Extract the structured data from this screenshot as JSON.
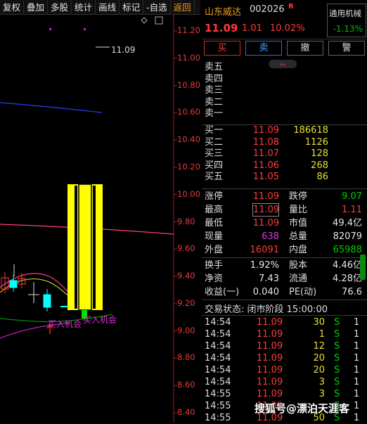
{
  "toolbar": {
    "items": [
      "复权",
      "叠加",
      "多股",
      "统计",
      "画线",
      "标记",
      "-自选",
      "返回"
    ]
  },
  "chart": {
    "price_labels": [
      "11.20",
      "11.00",
      "10.80",
      "10.60",
      "10.40",
      "10.20",
      "10.00",
      "9.80",
      "9.60",
      "9.40",
      "9.20",
      "9.00",
      "8.80",
      "8.60",
      "8.40"
    ],
    "high_marker": "11.09",
    "annotation_buy": "买入机会",
    "annotation_buy2": "买入机会",
    "colors": {
      "up": "#ffff00",
      "down": "#00ffff",
      "axis": "#e03c3c",
      "ma_blue": "#2a3aff",
      "ma_pink": "#ff3c8c",
      "ma_purple": "#c020c0"
    }
  },
  "stock": {
    "name": "山东威达",
    "code": "002026",
    "flag": "R",
    "price": "11.09",
    "change": "1.01",
    "change_pct": "10.02%",
    "sector_name": "通用机械",
    "sector_pct": "-1.13%"
  },
  "actions": {
    "buy": "买",
    "sell": "卖",
    "cancel": "撤",
    "alert": "警"
  },
  "asks": [
    {
      "label": "卖五",
      "price": "",
      "vol": ""
    },
    {
      "label": "卖四",
      "price": "",
      "vol": ""
    },
    {
      "label": "卖三",
      "price": "",
      "vol": ""
    },
    {
      "label": "卖二",
      "price": "",
      "vol": ""
    },
    {
      "label": "卖一",
      "price": "",
      "vol": ""
    }
  ],
  "bids": [
    {
      "label": "买一",
      "price": "11.09",
      "vol": "186618"
    },
    {
      "label": "买二",
      "price": "11.08",
      "vol": "1126"
    },
    {
      "label": "买三",
      "price": "11.07",
      "vol": "128"
    },
    {
      "label": "买四",
      "price": "11.06",
      "vol": "268"
    },
    {
      "label": "买五",
      "price": "11.05",
      "vol": "86"
    }
  ],
  "stats": {
    "limit_up_label": "涨停",
    "limit_up": "11.09",
    "limit_down_label": "跌停",
    "limit_down": "9.07",
    "high_label": "最高",
    "high": "11.09",
    "vol_ratio_label": "量比",
    "vol_ratio": "1.11",
    "low_label": "最低",
    "low": "11.09",
    "mkt_cap_label": "市值",
    "mkt_cap": "49.4亿",
    "cur_vol_label": "现量",
    "cur_vol": "638",
    "total_vol_label": "总量",
    "total_vol": "82079",
    "outer_label": "外盘",
    "outer": "16091",
    "inner_label": "内盘",
    "inner": "65988",
    "turnover_label": "换手",
    "turnover": "1.92%",
    "equity_label": "股本",
    "equity": "4.46亿",
    "nav_label": "净资",
    "nav": "7.43",
    "float_label": "流通",
    "float": "4.28亿",
    "eps_label": "收益(一)",
    "eps": "0.040",
    "pe_label": "PE(动)",
    "pe": "76.6"
  },
  "status": "交易状态: 闭市阶段 15:00:00",
  "ticks": [
    {
      "time": "14:54",
      "price": "11.09",
      "vol": "30",
      "side": "S",
      "n": "1"
    },
    {
      "time": "14:54",
      "price": "11.09",
      "vol": "1",
      "side": "S",
      "n": "1"
    },
    {
      "time": "14:54",
      "price": "11.09",
      "vol": "12",
      "side": "S",
      "n": "1"
    },
    {
      "time": "14:54",
      "price": "11.09",
      "vol": "20",
      "side": "S",
      "n": "1"
    },
    {
      "time": "14:54",
      "price": "11.09",
      "vol": "20",
      "side": "S",
      "n": "1"
    },
    {
      "time": "14:54",
      "price": "11.09",
      "vol": "3",
      "side": "S",
      "n": "1"
    },
    {
      "time": "14:55",
      "price": "11.09",
      "vol": "3",
      "side": "S",
      "n": "1"
    },
    {
      "time": "14:55",
      "price": "11.09",
      "vol": "",
      "side": "S",
      "n": "1"
    },
    {
      "time": "14:55",
      "price": "11.09",
      "vol": "50",
      "side": "S",
      "n": "1"
    }
  ],
  "watermark": "搜狐号@漂泊天涯客"
}
